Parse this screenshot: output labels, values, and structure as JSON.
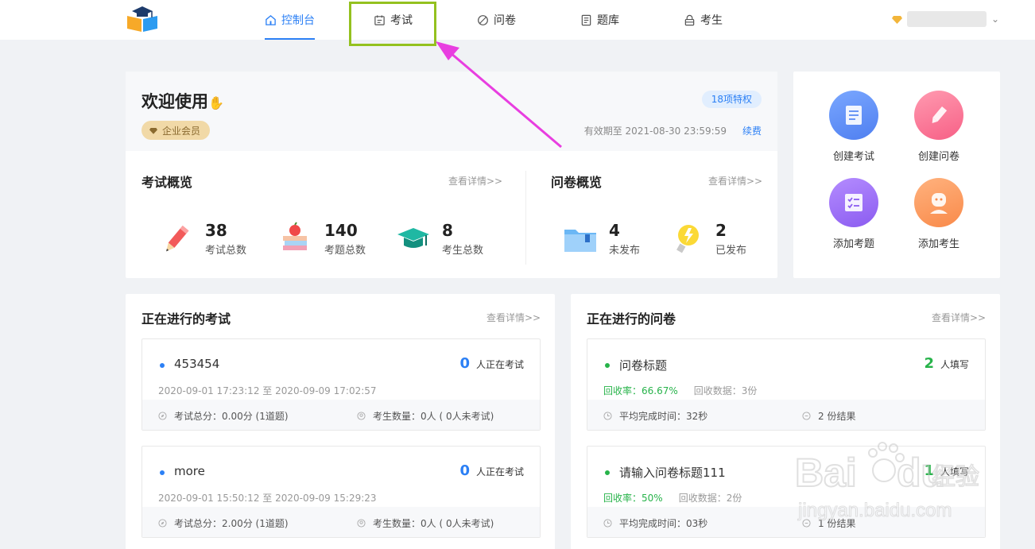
{
  "nav": {
    "items": [
      {
        "label": "控制台",
        "icon": "home-icon",
        "active": true
      },
      {
        "label": "考试",
        "icon": "calendar-icon",
        "active": false
      },
      {
        "label": "问卷",
        "icon": "leaf-icon",
        "active": false
      },
      {
        "label": "题库",
        "icon": "book-icon",
        "active": false
      },
      {
        "label": "考生",
        "icon": "lock-user-icon",
        "active": false
      }
    ]
  },
  "welcome": {
    "title": "欢迎使用",
    "member": "企业会员",
    "privilege": "18项特权",
    "expire": "有效期至 2021-08-30 23:59:59",
    "renew": "续费"
  },
  "exam_overview": {
    "title": "考试概览",
    "more": "查看详情>>",
    "stats": [
      {
        "num": "38",
        "label": "考试总数",
        "icon": "pencil-icon"
      },
      {
        "num": "140",
        "label": "考题总数",
        "icon": "books-apple-icon"
      },
      {
        "num": "8",
        "label": "考生总数",
        "icon": "grad-cap-icon"
      }
    ]
  },
  "survey_overview": {
    "title": "问卷概览",
    "more": "查看详情>>",
    "stats": [
      {
        "num": "4",
        "label": "未发布",
        "icon": "folder-icon"
      },
      {
        "num": "2",
        "label": "已发布",
        "icon": "bulb-icon"
      }
    ]
  },
  "quick_actions": [
    {
      "label": "创建考试",
      "icon": "document-icon",
      "color": "#5b8ff9"
    },
    {
      "label": "创建问卷",
      "icon": "pen-icon",
      "color": "#fb6f8c"
    },
    {
      "label": "添加考题",
      "icon": "checklist-icon",
      "color": "#9b6cf5"
    },
    {
      "label": "添加考生",
      "icon": "person-icon",
      "color": "#fc9a5c"
    }
  ],
  "ongoing_exams": {
    "title": "正在进行的考试",
    "more": "查看详情>>",
    "items": [
      {
        "name": "453454",
        "count": "0",
        "count_label": "人正在考试",
        "time": "2020-09-01 17:23:12 至 2020-09-09 17:02:57",
        "score": "考试总分：0.00分 (1道题)",
        "examinees": "考生数量：0人 ( 0人未考试)"
      },
      {
        "name": "more",
        "count": "0",
        "count_label": "人正在考试",
        "time": "2020-09-01 15:50:12 至 2020-09-09 15:29:23",
        "score": "考试总分：2.00分 (1道题)",
        "examinees": "考生数量：0人 ( 0人未考试)"
      }
    ]
  },
  "ongoing_surveys": {
    "title": "正在进行的问卷",
    "more": "查看详情>>",
    "items": [
      {
        "name": "问卷标题",
        "count": "2",
        "count_label": "人填写",
        "rate": "回收率：66.67%",
        "data": "回收数据：3份",
        "avg": "平均完成时间：32秒",
        "results": "2 份结果"
      },
      {
        "name": "请输入问卷标题111",
        "count": "1",
        "count_label": "人填写",
        "rate": "回收率：50%",
        "data": "回收数据：2份",
        "avg": "平均完成时间：03秒",
        "results": "1 份结果"
      }
    ]
  },
  "colors": {
    "accent": "#2c80f5",
    "green": "#27b34a",
    "highlight": "#94c11f",
    "arrow": "#e83ee0"
  },
  "watermark": {
    "text1": "Bai",
    "text2": "du",
    "text3": "经验",
    "sub": "jingyan.baidu.com"
  }
}
